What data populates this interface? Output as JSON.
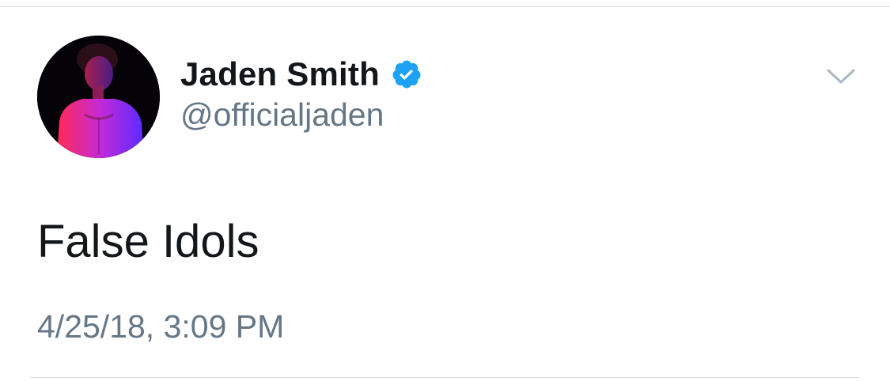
{
  "tweet": {
    "author": {
      "name": "Jaden Smith",
      "handle": "@officialjaden",
      "verified": true,
      "avatar_icon": "profile-photo"
    },
    "text": "False Idols",
    "timestamp": "4/25/18, 3:09 PM",
    "menu_icon": "chevron-down-icon"
  },
  "colors": {
    "name_text": "#14171a",
    "secondary_text": "#657786",
    "verified_blue": "#1da1f2",
    "divider": "#d6dbe0",
    "chevron": "#aab8c2"
  }
}
